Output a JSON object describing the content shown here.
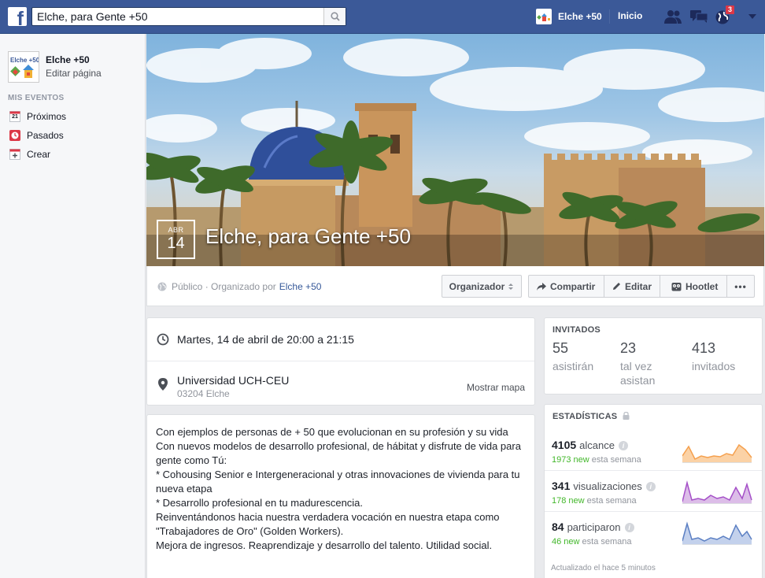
{
  "topbar": {
    "logo": "f",
    "search_value": "Elche, para Gente +50",
    "profile_name": "Elche +50",
    "home_label": "Inicio",
    "notifications_count": "3"
  },
  "leftnav": {
    "page_name": "Elche +50",
    "logo_text": "Elche +50",
    "edit_label": "Editar página",
    "section_title": "MIS EVENTOS",
    "calendar_day": "21",
    "items": [
      {
        "label": "Próximos",
        "icon": "calendar-icon"
      },
      {
        "label": "Pasados",
        "icon": "clock-icon"
      },
      {
        "label": "Crear",
        "icon": "plus-icon"
      }
    ]
  },
  "event": {
    "month": "ABR",
    "day": "14",
    "title": "Elche, para Gente +50",
    "privacy": "Público · Organizado por",
    "organizer": "Elche +50"
  },
  "actions": {
    "organizer_label": "Organizador",
    "share_label": "Compartir",
    "edit_label": "Editar",
    "hootlet_label": "Hootlet",
    "more_label": "•••"
  },
  "details": {
    "datetime": "Martes, 14 de abril de 20:00 a 21:15",
    "venue": "Universidad UCH-CEU",
    "address": "03204 Elche",
    "map_link": "Mostrar mapa"
  },
  "description": [
    "Con ejemplos de personas de + 50 que evolucionan en su profesión y su vida",
    "Con nuevos modelos de desarrollo profesional, de hábitat y disfrute de vida para gente como Tú:",
    "* Cohousing Senior e Intergeneracional y otras innovaciones de vivienda para tu nueva etapa",
    "* Desarrollo profesional en tu madurescencia.",
    "Reinventándonos hacia nuestra verdadera vocación en nuestra etapa como \"Trabajadores de Oro\" (Golden Workers).",
    "Mejora de ingresos. Reaprendizaje y desarrollo del talento. Utilidad social."
  ],
  "invited": {
    "title": "INVITADOS",
    "going": {
      "num": "55",
      "label": "asistirán"
    },
    "maybe": {
      "num": "23",
      "label": "tal vez asistan"
    },
    "invited": {
      "num": "413",
      "label": "invitados"
    }
  },
  "stats": {
    "title": "ESTADÍSTICAS",
    "rows": [
      {
        "num": "4105",
        "label": "alcance",
        "new": "1973 new",
        "period": "esta semana",
        "color": "#f5a04e",
        "fill": "#fbd2a6"
      },
      {
        "num": "341",
        "label": "visualizaciones",
        "new": "178 new",
        "period": "esta semana",
        "color": "#a550c8",
        "fill": "#dcbde8"
      },
      {
        "num": "84",
        "label": "participaron",
        "new": "46 new",
        "period": "esta semana",
        "color": "#5b7fc3",
        "fill": "#c3d1ec"
      }
    ],
    "updated": "Actualizado el hace 5 minutos"
  }
}
